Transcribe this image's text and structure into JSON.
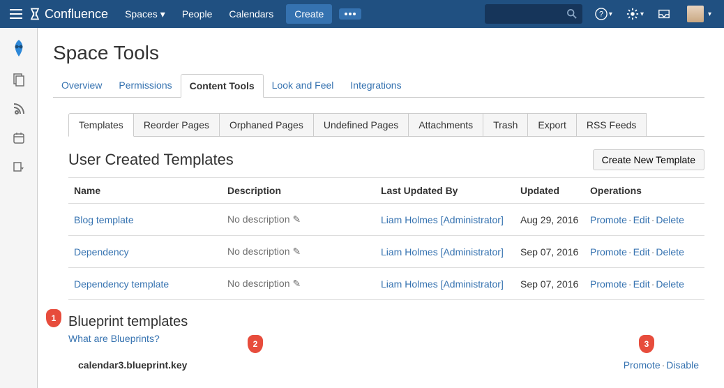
{
  "topbar": {
    "product_name": "Confluence",
    "nav": [
      "Spaces",
      "People",
      "Calendars"
    ],
    "create_label": "Create"
  },
  "page": {
    "title": "Space Tools"
  },
  "tabs_primary": [
    "Overview",
    "Permissions",
    "Content Tools",
    "Look and Feel",
    "Integrations"
  ],
  "tabs_primary_active": 2,
  "tabs_secondary": [
    "Templates",
    "Reorder Pages",
    "Orphaned Pages",
    "Undefined Pages",
    "Attachments",
    "Trash",
    "Export",
    "RSS Feeds"
  ],
  "tabs_secondary_active": 0,
  "user_templates": {
    "title": "User Created Templates",
    "create_button": "Create New Template",
    "columns": [
      "Name",
      "Description",
      "Last Updated By",
      "Updated",
      "Operations"
    ],
    "no_description": "No description",
    "ops": {
      "promote": "Promote",
      "edit": "Edit",
      "delete": "Delete"
    },
    "rows": [
      {
        "name": "Blog template",
        "updated_by": "Liam Holmes [Administrator]",
        "updated": "Aug 29, 2016"
      },
      {
        "name": "Dependency",
        "updated_by": "Liam Holmes [Administrator]",
        "updated": "Sep 07, 2016"
      },
      {
        "name": "Dependency template",
        "updated_by": "Liam Holmes [Administrator]",
        "updated": "Sep 07, 2016"
      }
    ]
  },
  "blueprints": {
    "title": "Blueprint templates",
    "help_link": "What are Blueprints?",
    "rows": [
      {
        "name": "calendar3.blueprint.key",
        "ops": {
          "promote": "Promote",
          "disable": "Disable"
        }
      }
    ]
  },
  "annotations": [
    "1",
    "2",
    "3"
  ]
}
